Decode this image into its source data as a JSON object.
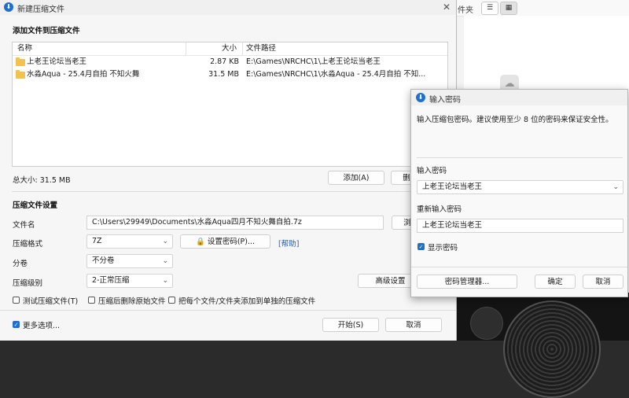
{
  "background": {
    "explorer_label": "件夹",
    "view_list_icon": "list-icon",
    "view_grid_icon": "grid-icon"
  },
  "dialog": {
    "title": "新建压缩文件",
    "close": "✕",
    "add_section_title": "添加文件到压缩文件",
    "columns": {
      "name": "名称",
      "size": "大小",
      "path": "文件路径"
    },
    "files": [
      {
        "name": "上老王论坛当老王",
        "size": "2.87 KB",
        "path": "E:\\Games\\NRCHC\\1\\上老王论坛当老王"
      },
      {
        "name": "水淼Aqua - 25.4月自拍 不知火舞",
        "size": "31.5 MB",
        "path": "E:\\Games\\NRCHC\\1\\水淼Aqua - 25.4月自拍 不知..."
      }
    ],
    "total_size": "总大小: 31.5 MB",
    "add_button": "添加(A)",
    "remove_button": "删",
    "settings_title": "压缩文件设置",
    "filename_label": "文件名",
    "filename_value": "C:\\Users\\29949\\Documents\\水淼Aqua四月不知火舞自拍.7z",
    "browse_button": "浏",
    "format_label": "压缩格式",
    "format_value": "7Z",
    "set_password_button": "设置密码(P)...",
    "help_link": "[帮助]",
    "split_label": "分卷",
    "split_value": "不分卷",
    "level_label": "压缩级别",
    "level_value": "2-正常压缩",
    "advanced_button": "高级设置",
    "opt_test": "测试压缩文件(T)",
    "opt_delete": "压缩后删除原始文件",
    "opt_separate": "把每个文件/文件夹添加到单独的压缩文件",
    "more_options": "更多选项...",
    "start_button": "开始(S)",
    "cancel_button": "取消"
  },
  "password_dialog": {
    "title": "输入密码",
    "hint": "输入压缩包密码。建议使用至少 8 位的密码来保证安全性。",
    "enter_label": "输入密码",
    "enter_value": "上老王论坛当老王",
    "reenter_label": "重新输入密码",
    "reenter_value": "上老王论坛当老王",
    "show_password": "显示密码",
    "manager_button": "密码管理器...",
    "ok_button": "确定",
    "cancel_button": "取消",
    "close": "✕"
  }
}
